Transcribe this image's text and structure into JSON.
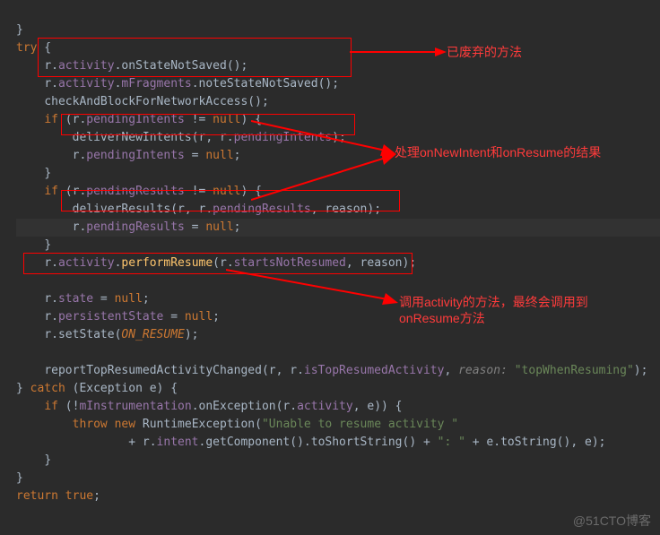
{
  "annotations": {
    "a1": "已废弃的方法",
    "a2": "处理onNewIntent和onResume的结果",
    "a3": "调用activity的方法，最终会调用到onResume方法"
  },
  "watermark": "@51CTO博客",
  "code": {
    "l0": "}",
    "l1a": "try",
    "l1b": " {",
    "l2a": "r.",
    "l2b": "activity",
    "l2c": ".onStateNotSaved();",
    "l3a": "r.",
    "l3b": "activity",
    "l3c": ".",
    "l3d": "mFragments",
    "l3e": ".noteStateNotSaved();",
    "l4": "checkAndBlockForNetworkAccess();",
    "l5a": "if",
    "l5b": " (r.",
    "l5c": "pendingIntents",
    "l5d": " != ",
    "l5e": "null",
    "l5f": ") {",
    "l6a": "deliverNewIntents(r, r.",
    "l6b": "pendingIntents",
    "l6c": ");",
    "l7a": "r.",
    "l7b": "pendingIntents",
    "l7c": " = ",
    "l7d": "null",
    "l7e": ";",
    "l8": "}",
    "l9a": "if",
    "l9b": " (r.",
    "l9c": "pendingResults",
    "l9d": " != ",
    "l9e": "null",
    "l9f": ") {",
    "l10a": "deliverResults(r, r.",
    "l10b": "pendingResults",
    "l10c": ", reason);",
    "l11a": "r.",
    "l11b": "pendingResults",
    "l11c": " = ",
    "l11d": "null",
    "l11e": ";",
    "l12": "}",
    "l13a": "r.",
    "l13b": "activity",
    "l13c": ".",
    "l13d": "performResume",
    "l13e": "(r.",
    "l13f": "startsNotResumed",
    "l13g": ", reason);",
    "l15a": "r.",
    "l15b": "state",
    "l15c": " = ",
    "l15d": "null",
    "l15e": ";",
    "l16a": "r.",
    "l16b": "persistentState",
    "l16c": " = ",
    "l16d": "null",
    "l16e": ";",
    "l17a": "r.setState(",
    "l17b": "ON_RESUME",
    "l17c": ");",
    "l19a": "reportTopResumedActivityChanged(r, r.",
    "l19b": "isTopResumedActivity",
    "l19c": ", ",
    "l19h": "reason:",
    "l19d": " \"topWhenResuming\"",
    "l19e": ");",
    "l20a": "} ",
    "l20b": "catch",
    "l20c": " (Exception e) {",
    "l21a": "if",
    "l21b": " (!",
    "l21c": "mInstrumentation",
    "l21d": ".onException(r.",
    "l21e": "activity",
    "l21f": ", e)) {",
    "l22a": "throw new ",
    "l22b": "RuntimeException(",
    "l22c": "\"Unable to resume activity \"",
    "l23a": "+ r.",
    "l23b": "intent",
    "l23c": ".getComponent().toShortString() + ",
    "l23d": "\": \"",
    "l23e": " + e.toString(), e);",
    "l24": "}",
    "l25": "}",
    "l26a": "return ",
    "l26b": "true",
    "l26c": ";"
  }
}
